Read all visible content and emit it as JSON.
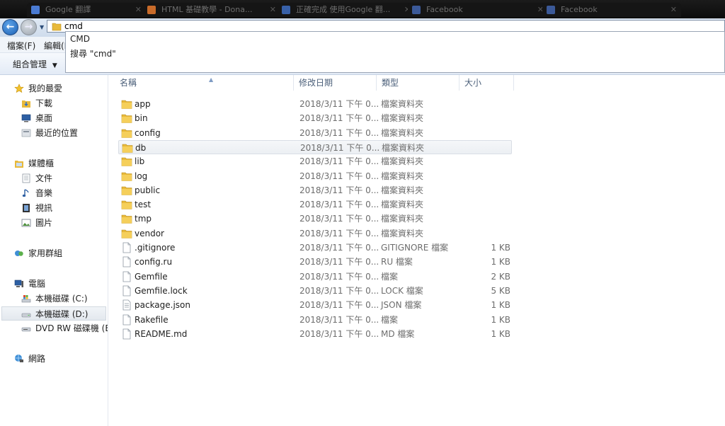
{
  "tabs": [
    {
      "title": "Google 翻譯",
      "color": "#4a7bd3"
    },
    {
      "title": "HTML 基礎教學 - Dona...",
      "color": "#c86b2a"
    },
    {
      "title": "正確完成 使用Google 翻...",
      "color": "#3760a8"
    },
    {
      "title": "Facebook",
      "color": "#3b5998"
    },
    {
      "title": "Facebook",
      "color": "#3b5998"
    }
  ],
  "address": {
    "value": "cmd"
  },
  "suggestions": [
    "CMD",
    "搜尋 \"cmd\""
  ],
  "menu": [
    "檔案(F)",
    "編輯(E)"
  ],
  "toolbar": {
    "organize_label": "組合管理"
  },
  "nav": {
    "favorites": {
      "label": "我的最愛",
      "items": [
        "下載",
        "桌面",
        "最近的位置"
      ]
    },
    "libraries": {
      "label": "媒體櫃",
      "items": [
        "文件",
        "音樂",
        "視訊",
        "圖片"
      ]
    },
    "homegroup": {
      "label": "家用群組"
    },
    "computer": {
      "label": "電腦",
      "items": [
        "本機磁碟 (C:)",
        "本機磁碟 (D:)",
        "DVD RW 磁碟機 (E:"
      ]
    },
    "network": {
      "label": "網路"
    }
  },
  "columns": [
    "名稱",
    "修改日期",
    "類型",
    "大小"
  ],
  "files": [
    {
      "name": "app",
      "date": "2018/3/11 下午 0...",
      "type": "檔案資料夾",
      "size": "",
      "kind": "folder"
    },
    {
      "name": "bin",
      "date": "2018/3/11 下午 0...",
      "type": "檔案資料夾",
      "size": "",
      "kind": "folder"
    },
    {
      "name": "config",
      "date": "2018/3/11 下午 0...",
      "type": "檔案資料夾",
      "size": "",
      "kind": "folder"
    },
    {
      "name": "db",
      "date": "2018/3/11 下午 0...",
      "type": "檔案資料夾",
      "size": "",
      "kind": "folder"
    },
    {
      "name": "lib",
      "date": "2018/3/11 下午 0...",
      "type": "檔案資料夾",
      "size": "",
      "kind": "folder"
    },
    {
      "name": "log",
      "date": "2018/3/11 下午 0...",
      "type": "檔案資料夾",
      "size": "",
      "kind": "folder"
    },
    {
      "name": "public",
      "date": "2018/3/11 下午 0...",
      "type": "檔案資料夾",
      "size": "",
      "kind": "folder"
    },
    {
      "name": "test",
      "date": "2018/3/11 下午 0...",
      "type": "檔案資料夾",
      "size": "",
      "kind": "folder"
    },
    {
      "name": "tmp",
      "date": "2018/3/11 下午 0...",
      "type": "檔案資料夾",
      "size": "",
      "kind": "folder"
    },
    {
      "name": "vendor",
      "date": "2018/3/11 下午 0...",
      "type": "檔案資料夾",
      "size": "",
      "kind": "folder"
    },
    {
      "name": ".gitignore",
      "date": "2018/3/11 下午 0...",
      "type": "GITIGNORE 檔案",
      "size": "1 KB",
      "kind": "file"
    },
    {
      "name": "config.ru",
      "date": "2018/3/11 下午 0...",
      "type": "RU 檔案",
      "size": "1 KB",
      "kind": "file"
    },
    {
      "name": "Gemfile",
      "date": "2018/3/11 下午 0...",
      "type": "檔案",
      "size": "2 KB",
      "kind": "file"
    },
    {
      "name": "Gemfile.lock",
      "date": "2018/3/11 下午 0...",
      "type": "LOCK 檔案",
      "size": "5 KB",
      "kind": "file"
    },
    {
      "name": "package.json",
      "date": "2018/3/11 下午 0...",
      "type": "JSON 檔案",
      "size": "1 KB",
      "kind": "file-json"
    },
    {
      "name": "Rakefile",
      "date": "2018/3/11 下午 0...",
      "type": "檔案",
      "size": "1 KB",
      "kind": "file"
    },
    {
      "name": "README.md",
      "date": "2018/3/11 下午 0...",
      "type": "MD 檔案",
      "size": "1 KB",
      "kind": "file"
    }
  ],
  "highlighted_row": "db",
  "colors": {
    "folder": "#e8b93a",
    "selection": "#eceff3",
    "header_text": "#4c607a",
    "back_button": "#1b5fb3"
  }
}
